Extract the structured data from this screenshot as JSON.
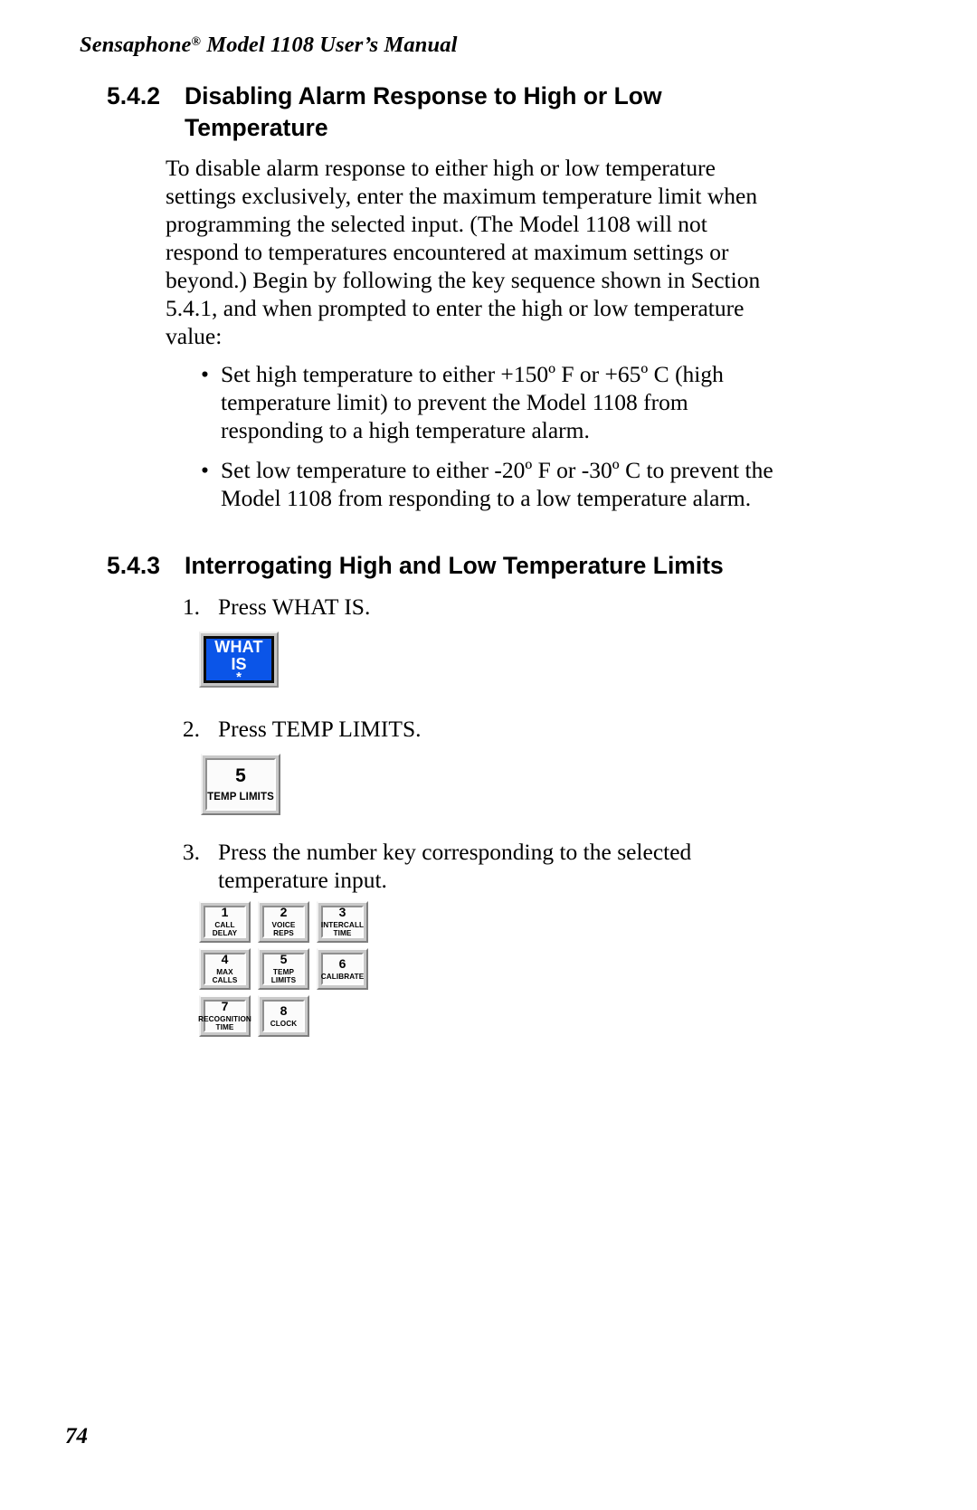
{
  "document": {
    "running_header": "Sensaphone",
    "running_header_registered": "®",
    "running_header_rest": " Model 1108 User’s Manual",
    "page_number": "74"
  },
  "sections": [
    {
      "number": "5.4.2",
      "title_line1": "Disabling Alarm Response to High or Low",
      "title_line2": "Temperature",
      "title_full": "Disabling Alarm Response to High or Low Temperature",
      "paragraph": "To disable alarm response to either high or low temperature settings exclusively, enter the maximum temperature limit when programming the selected input. (The Model 1108 will not respond to temperatures encountered at maximum settings or beyond.) Begin by following the key sequence shown in Section 5.4.1, and when prompted to enter the high or low temperature value:",
      "bullets": [
        {
          "marker": "•",
          "text": "Set high temperature to either +150º F or +65º C (high temperature limit) to prevent the Model 1108 from responding to a high temperature alarm."
        },
        {
          "marker": "•",
          "text": "Set low temperature to either -20º F or -30º C to prevent the Model 1108 from responding to a low temperature alarm."
        }
      ]
    },
    {
      "number": "5.4.3",
      "title_full": "Interrogating High and Low Temperature Limits",
      "steps": [
        {
          "number": "1.",
          "text": "Press WHAT IS."
        },
        {
          "number": "2.",
          "text": "Press TEMP LIMITS."
        },
        {
          "number": "3.",
          "text": "Press the number key corresponding to the selected temperature input."
        }
      ]
    }
  ],
  "keys": {
    "what_is": {
      "line1": "WHAT",
      "line2": "IS",
      "line3": "*",
      "face_color": "#0b55e8",
      "text_color": "#ffffff",
      "bezel_color": "#c6c6c6"
    },
    "temp_limits_large": {
      "digit": "5",
      "caption": "TEMP LIMITS"
    },
    "keypad_rows": [
      [
        {
          "digit": "1",
          "caption_line1": "CALL",
          "caption_line2": "DELAY"
        },
        {
          "digit": "2",
          "caption_line1": "VOICE",
          "caption_line2": "REPS"
        },
        {
          "digit": "3",
          "caption_line1": "INTERCALL",
          "caption_line2": "TIME"
        }
      ],
      [
        {
          "digit": "4",
          "caption_line1": "MAX CALLS",
          "caption_line2": ""
        },
        {
          "digit": "5",
          "caption_line1": "TEMP LIMITS",
          "caption_line2": ""
        },
        {
          "digit": "6",
          "caption_line1": "CALIBRATE",
          "caption_line2": ""
        }
      ],
      [
        {
          "digit": "7",
          "caption_line1": "RECOGNITION",
          "caption_line2": "TIME"
        },
        {
          "digit": "8",
          "caption_line1": "CLOCK",
          "caption_line2": ""
        }
      ]
    ]
  }
}
